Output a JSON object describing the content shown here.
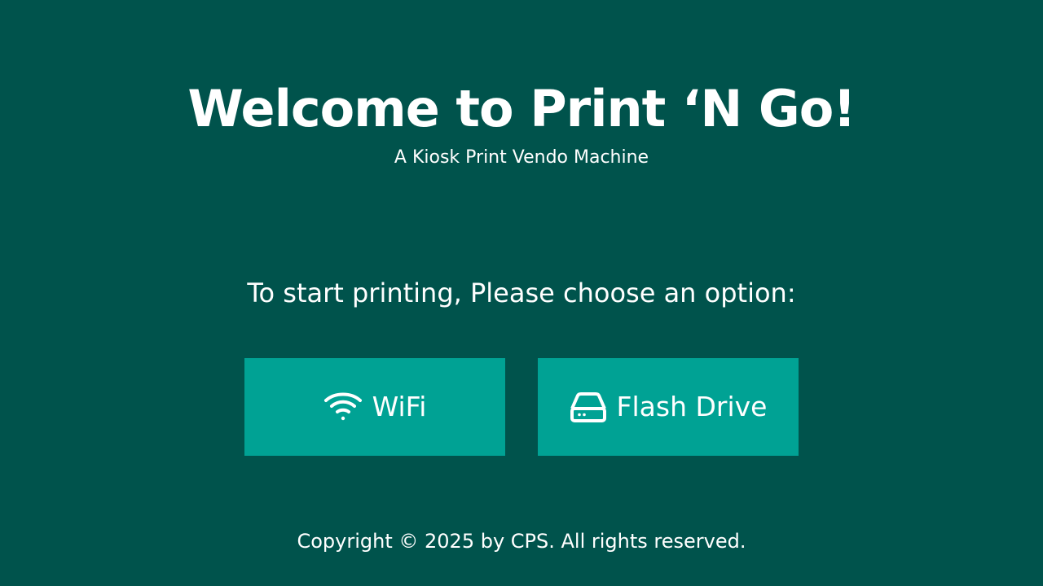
{
  "header": {
    "title": "Welcome to Print ‘N Go!",
    "subtitle": "A Kiosk Print Vendo Machine"
  },
  "prompt": "To start printing, Please choose an option:",
  "options": [
    {
      "label": "WiFi",
      "icon": "wifi-icon"
    },
    {
      "label": "Flash Drive",
      "icon": "hard-drive-icon"
    }
  ],
  "footer": {
    "copyright": "Copyright © 2025 by CPS. All rights reserved."
  },
  "colors": {
    "background": "#00534c",
    "button": "#00a294",
    "text": "#ffffff"
  }
}
